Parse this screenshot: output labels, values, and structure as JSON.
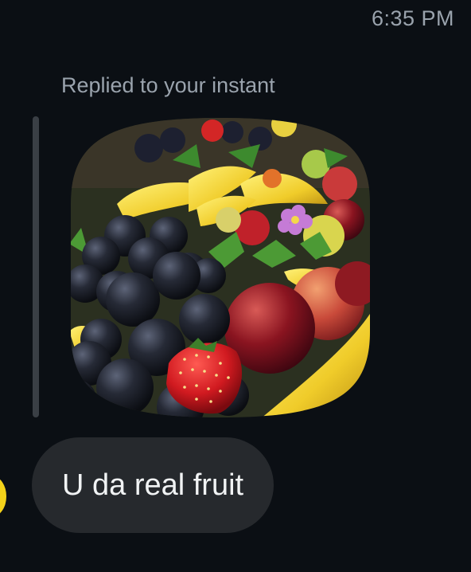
{
  "header": {
    "timestamp": "6:35 PM"
  },
  "reply": {
    "label": "Replied to your instant",
    "photo_subject": "fruit-platter-photo"
  },
  "message": {
    "text": "U da real fruit"
  },
  "colors": {
    "background": "#0b0f14",
    "bubble": "#26292d",
    "muted_text": "#9aa3ad",
    "avatar": "#f4d21a"
  }
}
